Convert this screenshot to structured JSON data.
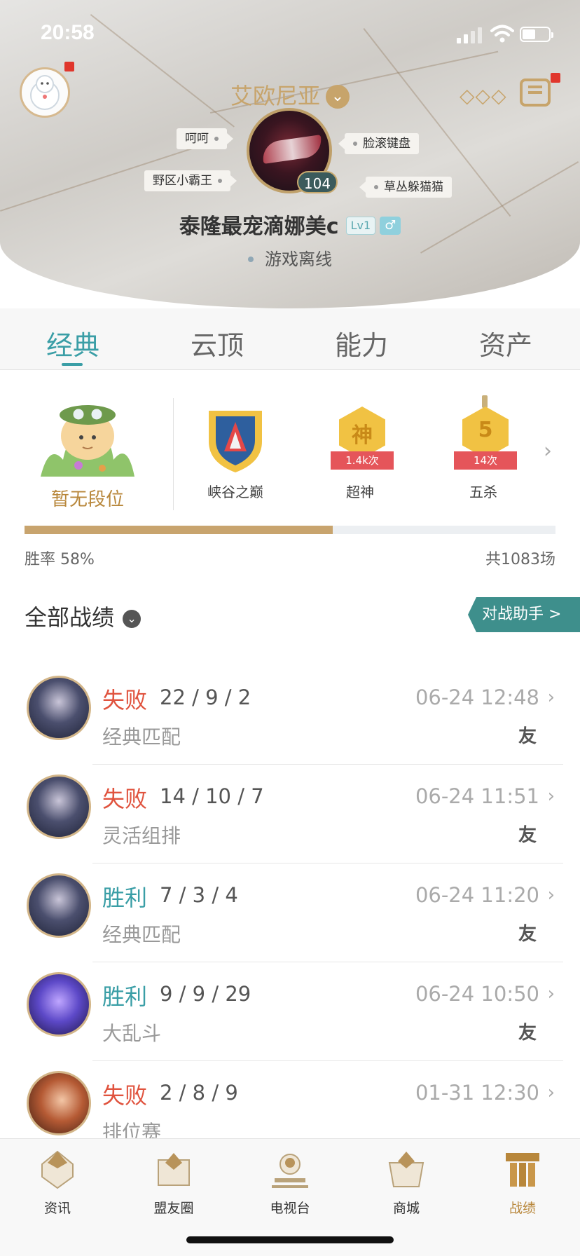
{
  "status_bar": {
    "time": "20:58"
  },
  "profile": {
    "server": "艾欧尼亚",
    "level": "104",
    "nickname": "泰隆最宠滴娜美c",
    "lv_badge": "Lv1",
    "gender_symbol": "♂",
    "online_status": "游戏离线",
    "tags": [
      "呵呵",
      "野区小霸王",
      "脸滚键盘",
      "草丛躲猫猫"
    ]
  },
  "tabs": [
    "经典",
    "云顶",
    "能力",
    "资产"
  ],
  "rank": {
    "label": "暂无段位"
  },
  "achievements": [
    {
      "name": "峡谷之巅",
      "count": ""
    },
    {
      "name": "超神",
      "count": "1.4k次",
      "glyph": "神"
    },
    {
      "name": "五杀",
      "count": "14次",
      "glyph": "5"
    }
  ],
  "stats": {
    "win_rate_text": "胜率 58%",
    "win_rate": 0.58,
    "total_text": "共1083场"
  },
  "records": {
    "title": "全部战绩",
    "assist_button": "对战助手 >",
    "matches": [
      {
        "result": "失败",
        "kda": "22 / 9 / 2",
        "mode": "经典匹配",
        "time": "06-24 12:48",
        "tag": "友",
        "outcome": "lose"
      },
      {
        "result": "失败",
        "kda": "14 / 10 / 7",
        "mode": "灵活组排",
        "time": "06-24 11:51",
        "tag": "友",
        "outcome": "lose"
      },
      {
        "result": "胜利",
        "kda": "7 / 3 / 4",
        "mode": "经典匹配",
        "time": "06-24 11:20",
        "tag": "友",
        "outcome": "win"
      },
      {
        "result": "胜利",
        "kda": "9 / 9 / 29",
        "mode": "大乱斗",
        "time": "06-24 10:50",
        "tag": "友",
        "outcome": "win"
      },
      {
        "result": "失败",
        "kda": "2 / 8 / 9",
        "mode": "排位赛",
        "time": "01-31 12:30",
        "tag": "",
        "outcome": "lose"
      }
    ]
  },
  "bottom_nav": {
    "items": [
      {
        "label": "资讯",
        "icon": "news-icon"
      },
      {
        "label": "盟友圈",
        "icon": "friends-icon"
      },
      {
        "label": "电视台",
        "icon": "tv-icon"
      },
      {
        "label": "商城",
        "icon": "shop-icon"
      },
      {
        "label": "战绩",
        "icon": "record-icon"
      }
    ],
    "active": "战绩"
  },
  "colors": {
    "accent": "#3a9ea6",
    "gold": "#c7a46b",
    "lose": "#e0533e",
    "win": "#3a9ea6"
  }
}
